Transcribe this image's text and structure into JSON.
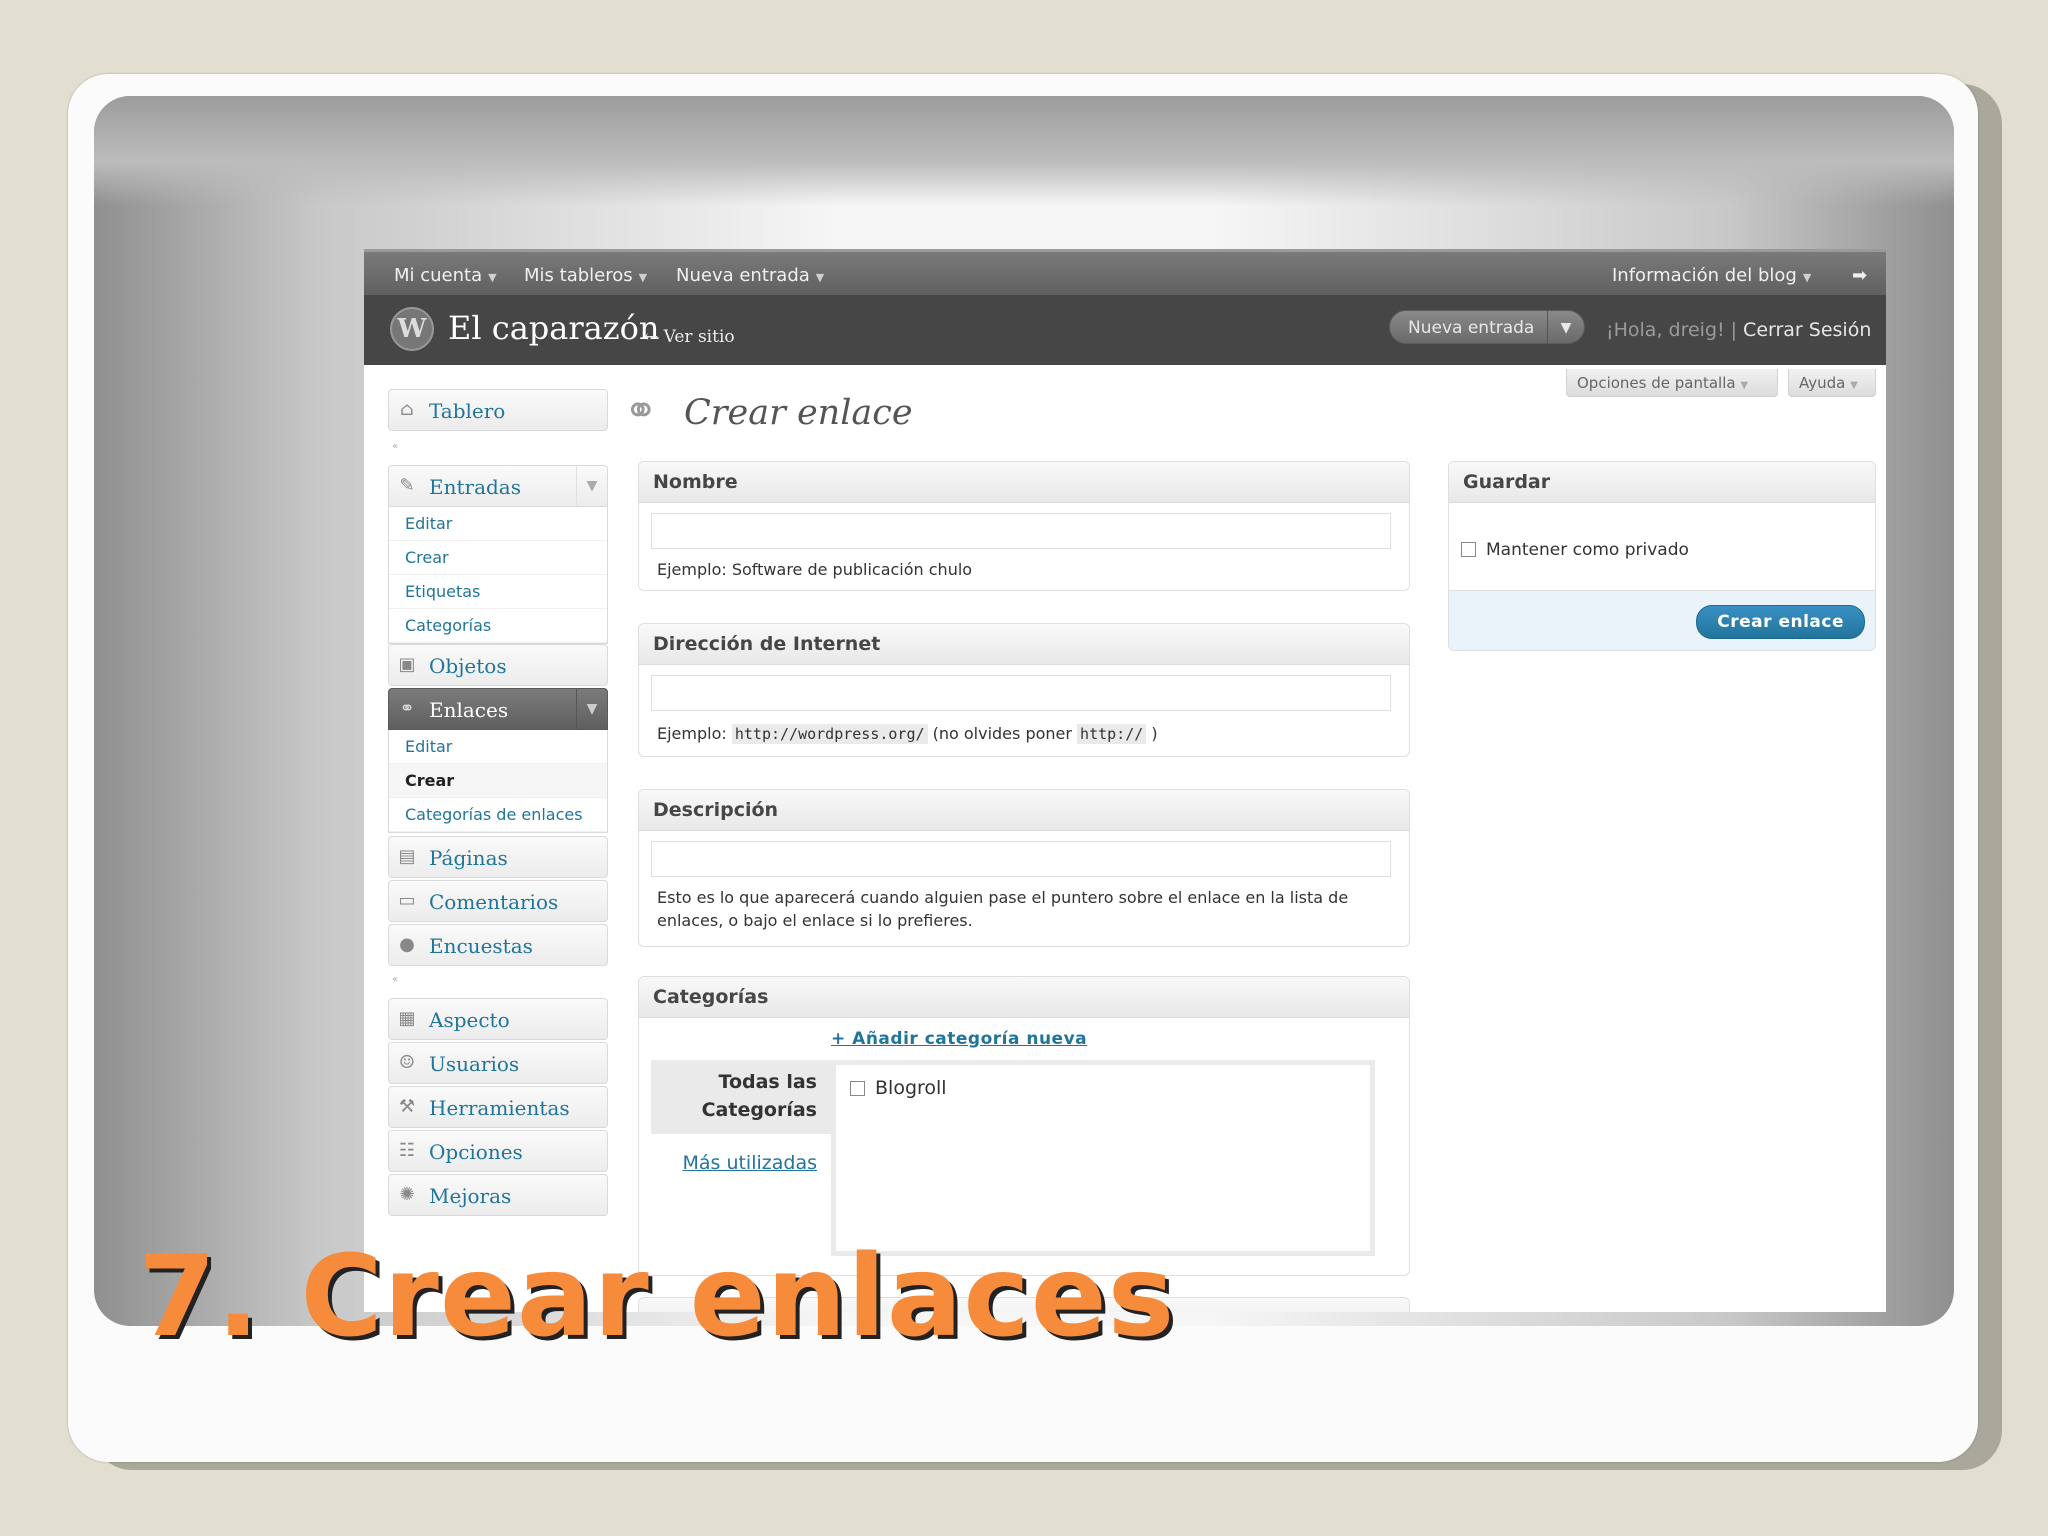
{
  "topbar": {
    "mi_cuenta": "Mi cuenta",
    "mis_tableros": "Mis tableros",
    "nueva_entrada": "Nueva entrada",
    "info_blog": "Información del blog"
  },
  "header": {
    "site_title": "El caparazón",
    "ver_sitio": "← Ver sitio",
    "fav_action": "Nueva entrada",
    "greeting": "¡Hola, dreig!",
    "separator": "|",
    "logout": "Cerrar Sesión"
  },
  "screen_options": "Opciones de pantalla",
  "help": "Ayuda",
  "menu": {
    "tablero": "Tablero",
    "entradas": "Entradas",
    "entradas_sub": [
      "Editar",
      "Crear",
      "Etiquetas",
      "Categorías"
    ],
    "objetos": "Objetos",
    "enlaces": "Enlaces",
    "enlaces_sub": [
      "Editar",
      "Crear",
      "Categorías de enlaces"
    ],
    "paginas": "Páginas",
    "comentarios": "Comentarios",
    "encuestas": "Encuestas",
    "aspecto": "Aspecto",
    "usuarios": "Usuarios",
    "herramientas": "Herramientas",
    "opciones": "Opciones",
    "mejoras": "Mejoras"
  },
  "page": {
    "title": "Crear enlace"
  },
  "nombre": {
    "heading": "Nombre",
    "value": "",
    "hint": "Ejemplo: Software de publicación chulo"
  },
  "direccion": {
    "heading": "Dirección de Internet",
    "value": "",
    "hint_prefix": "Ejemplo:",
    "hint_code1": "http://wordpress.org/",
    "hint_middle": "(no olvides poner",
    "hint_code2": "http://",
    "hint_suffix": ")"
  },
  "descripcion": {
    "heading": "Descripción",
    "value": "",
    "hint": "Esto es lo que aparecerá cuando alguien pase el puntero sobre el enlace en la lista de enlaces, o bajo el enlace si lo prefieres."
  },
  "categorias": {
    "heading": "Categorías",
    "add_new": "+ Añadir categoría nueva",
    "tab_all": "Todas las Categorías",
    "tab_popular": "Más utilizadas",
    "items": [
      "Blogroll"
    ]
  },
  "guardar": {
    "heading": "Guardar",
    "private_label": "Mantener como privado",
    "submit": "Crear enlace"
  },
  "caption": "7. Crear enlaces",
  "colors": {
    "caption": "#f58b3b",
    "link": "#21759b",
    "header_bg": "#464646"
  }
}
